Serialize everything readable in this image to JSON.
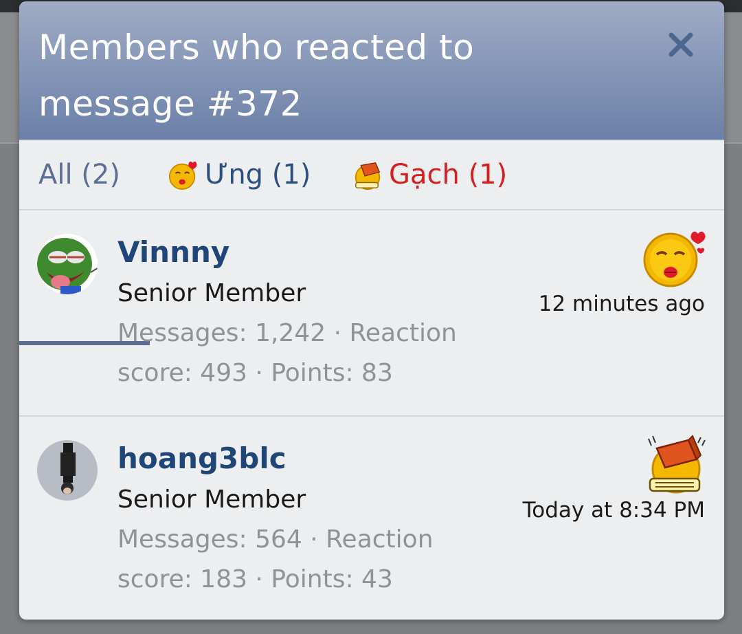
{
  "modal": {
    "title": "Members who reacted to message #372",
    "close_icon": "close-icon"
  },
  "tabs": [
    {
      "label": "All (2)",
      "active": true,
      "color": "#5a6f93"
    },
    {
      "label": "Ưng (1)",
      "icon": "kiss-emoji-icon",
      "color": "#2d4f80"
    },
    {
      "label": "Gạch (1)",
      "icon": "brick-emoji-icon",
      "color": "#d32020"
    }
  ],
  "members": [
    {
      "name": "Vinnny",
      "title": "Senior Member",
      "stats": "Messages: 1,242 · Reaction score: 493 · Points: 83",
      "reaction_icon": "kiss-emoji-icon",
      "time": "12 minutes ago"
    },
    {
      "name": "hoang3blc",
      "title": "Senior Member",
      "stats": "Messages: 564 · Reaction score: 183 · Points: 43",
      "reaction_icon": "brick-emoji-icon",
      "time": "Today at 8:34 PM"
    }
  ],
  "colors": {
    "header_top": "#a0acc5",
    "header_bottom": "#6b80a8",
    "username": "#1f4677",
    "tab_active_underline": "#5b6d8f",
    "gach_red": "#d32020"
  }
}
